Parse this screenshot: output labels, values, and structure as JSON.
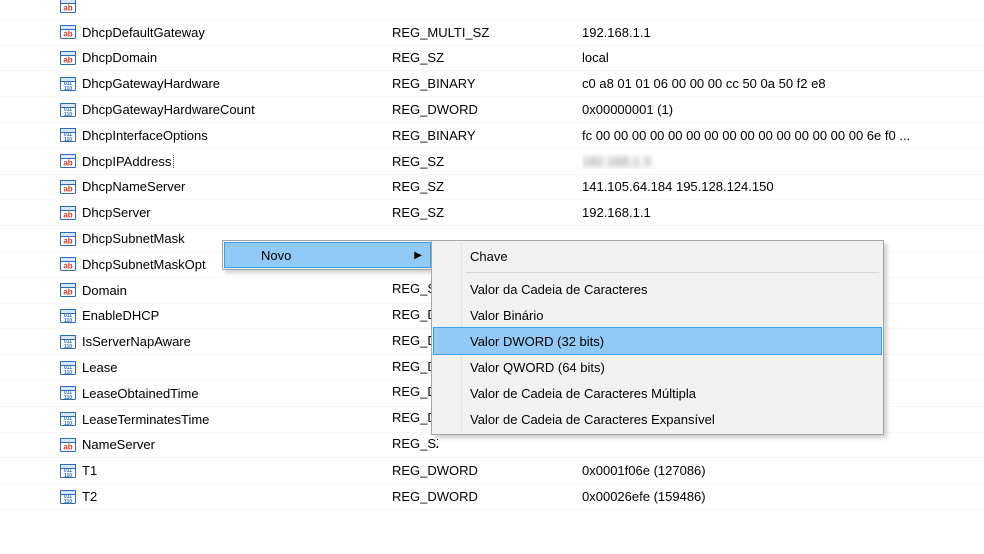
{
  "rows": [
    {
      "iconType": "ab",
      "name": "",
      "type": "",
      "data": ""
    },
    {
      "iconType": "ab",
      "name": "DhcpDefaultGateway",
      "type": "REG_MULTI_SZ",
      "data": "192.168.1.1"
    },
    {
      "iconType": "ab",
      "name": "DhcpDomain",
      "type": "REG_SZ",
      "data": "local"
    },
    {
      "iconType": "bin",
      "name": "DhcpGatewayHardware",
      "type": "REG_BINARY",
      "data": "c0 a8 01 01 06 00 00 00 cc 50 0a 50 f2 e8"
    },
    {
      "iconType": "bin",
      "name": "DhcpGatewayHardwareCount",
      "type": "REG_DWORD",
      "data": "0x00000001 (1)"
    },
    {
      "iconType": "bin",
      "name": "DhcpInterfaceOptions",
      "type": "REG_BINARY",
      "data": "fc 00 00 00 00 00 00 00 00 00 00 00 00 00 00 00 6e f0 ..."
    },
    {
      "iconType": "ab",
      "name": "DhcpIPAddress",
      "type": "REG_SZ",
      "data": "192.168.1.3",
      "selected": true,
      "blurData": true
    },
    {
      "iconType": "ab",
      "name": "DhcpNameServer",
      "type": "REG_SZ",
      "data": "141.105.64.184 195.128.124.150"
    },
    {
      "iconType": "ab",
      "name": "DhcpServer",
      "type": "REG_SZ",
      "data": "192.168.1.1"
    },
    {
      "iconType": "ab",
      "name": "DhcpSubnetMask",
      "type": "",
      "data": "",
      "truncType": true
    },
    {
      "iconType": "ab",
      "name": "DhcpSubnetMaskOpt",
      "type": "",
      "data": "",
      "truncType": true
    },
    {
      "iconType": "ab",
      "name": "Domain",
      "type": "REG_SZ",
      "data": "",
      "truncType": true
    },
    {
      "iconType": "bin",
      "name": "EnableDHCP",
      "type": "REG_DWORD",
      "data": "",
      "truncType": true
    },
    {
      "iconType": "bin",
      "name": "IsServerNapAware",
      "type": "REG_DWORD",
      "data": "",
      "truncType": true
    },
    {
      "iconType": "bin",
      "name": "Lease",
      "type": "REG_DWORD",
      "data": "",
      "truncType": true
    },
    {
      "iconType": "bin",
      "name": "LeaseObtainedTime",
      "type": "REG_DWORD",
      "data": "",
      "truncType": true
    },
    {
      "iconType": "bin",
      "name": "LeaseTerminatesTime",
      "type": "REG_DWORD",
      "data": "",
      "truncType": true
    },
    {
      "iconType": "ab",
      "name": "NameServer",
      "type": "REG_SZ",
      "data": "",
      "truncType": true
    },
    {
      "iconType": "bin",
      "name": "T1",
      "type": "REG_DWORD",
      "data": "0x0001f06e (127086)"
    },
    {
      "iconType": "bin",
      "name": "T2",
      "type": "REG_DWORD",
      "data": "0x00026efe (159486)"
    }
  ],
  "context_menu": {
    "novo": "Novo",
    "arrow": "▶"
  },
  "submenu": {
    "chave": "Chave",
    "cadeia": "Valor da Cadeia de Caracteres",
    "binario": "Valor Binário",
    "dword": "Valor DWORD (32 bits)",
    "qword": "Valor QWORD (64 bits)",
    "multipla": "Valor de Cadeia de Caracteres Múltipla",
    "expansivel": "Valor de Cadeia de Caracteres Expansível"
  }
}
